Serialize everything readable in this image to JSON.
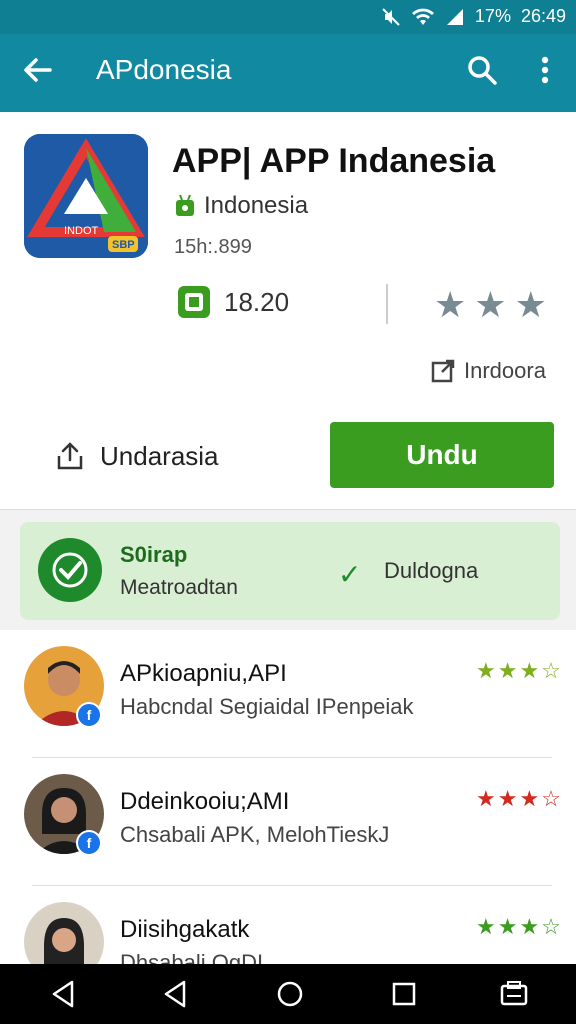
{
  "status": {
    "battery": "17%",
    "time": "26:49"
  },
  "appbar": {
    "title": "APdonesia"
  },
  "app": {
    "title": "APP| APP Indanesia",
    "developer": "Indonesia",
    "size": "15h:.899",
    "rating": "18.20",
    "link_label": "Inrdoora",
    "share_label": "Undarasia",
    "install_label": "Undu",
    "icon_label": "INDOT",
    "icon_tag": "SBP"
  },
  "verify": {
    "title": "S0irap",
    "subtitle": "Meatroadtan",
    "status": "Duldogna"
  },
  "reviews": [
    {
      "name": "APkioapniu,API",
      "text": "Habcndal Segiaidal IPenpeiak",
      "stars": "★★★☆",
      "star_color": "#7fae1f"
    },
    {
      "name": "Ddeinkooiu;AMI",
      "text": "Chsabali APK, MelohTieskJ",
      "stars": "★★★☆",
      "star_color": "#d22a1e"
    },
    {
      "name": "Diisihgakatk",
      "text": "Dhsabali OgDI",
      "stars": "★★★☆",
      "star_color": "#3a9d20"
    }
  ],
  "colors": {
    "accent": "#1189a0",
    "install": "#3a9d20",
    "verify_bg": "#d9efd3"
  }
}
